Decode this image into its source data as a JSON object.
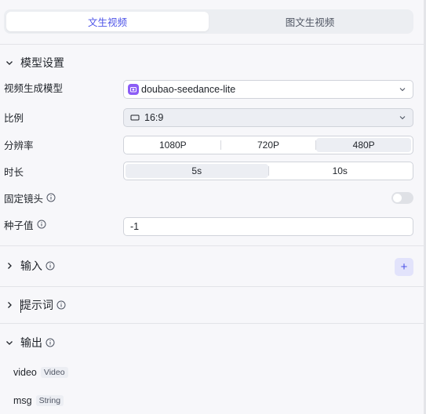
{
  "mode_tabs": [
    {
      "label": "文生视频",
      "active": true
    },
    {
      "label": "图文生视频",
      "active": false
    }
  ],
  "model_settings": {
    "title": "模型设置",
    "model": {
      "label": "视频生成模型",
      "value": "doubao-seedance-lite"
    },
    "ratio": {
      "label": "比例",
      "value": "16:9"
    },
    "resolution": {
      "label": "分辨率",
      "options": [
        "1080P",
        "720P",
        "480P"
      ],
      "selected": "480P"
    },
    "duration": {
      "label": "时长",
      "options": [
        "5s",
        "10s"
      ],
      "selected": "5s"
    },
    "fixed_camera": {
      "label": "固定镜头",
      "enabled": false
    },
    "seed": {
      "label": "种子值",
      "value": "-1"
    }
  },
  "input_section": {
    "title": "输入",
    "add_label": "+"
  },
  "prompt_section": {
    "title": "提示词"
  },
  "output_section": {
    "title": "输出",
    "items": [
      {
        "name": "video",
        "type": "Video"
      },
      {
        "name": "msg",
        "type": "String"
      }
    ]
  },
  "colors": {
    "accent": "#4d53e8",
    "model_badge": "#8b5cf6"
  }
}
